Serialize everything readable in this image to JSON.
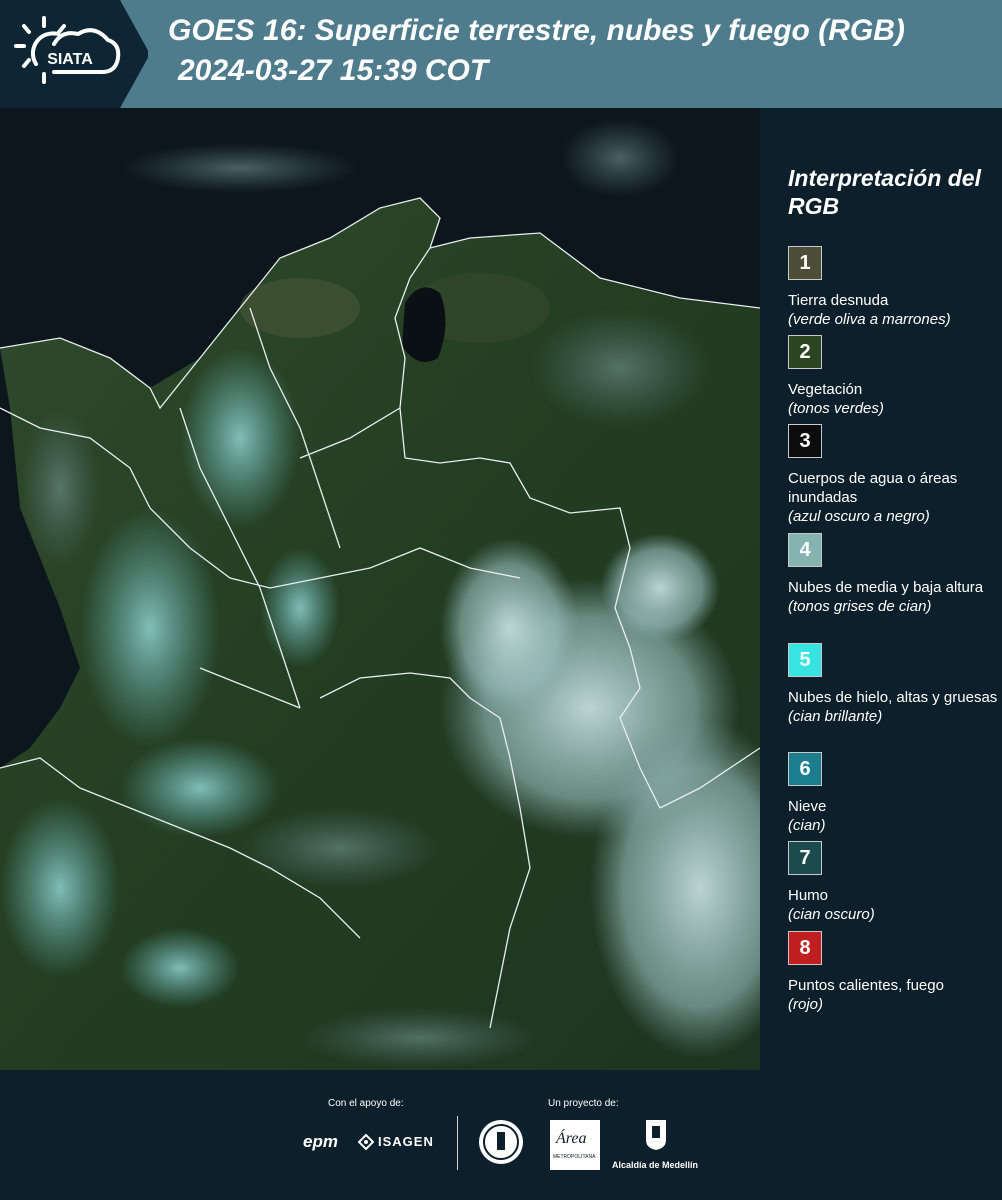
{
  "header": {
    "logo_text": "SIATA",
    "title_line1": "GOES 16: Superficie terrestre, nubes y fuego (RGB)",
    "title_line2": "2024-03-27 15:39 COT"
  },
  "legend": {
    "title": "Interpretación del RGB",
    "items": [
      {
        "num": "1",
        "label": "Tierra desnuda",
        "sub": "(verde oliva a marrones)",
        "color": "#4e4d38"
      },
      {
        "num": "2",
        "label": "Vegetación",
        "sub": "(tonos verdes)",
        "color": "#2b4520"
      },
      {
        "num": "3",
        "label": "Cuerpos de agua o áreas inundadas",
        "sub": "(azul oscuro a negro)",
        "color": "#0c0c0c"
      },
      {
        "num": "4",
        "label": "Nubes de media y baja altura",
        "sub": "(tonos grises de cian)",
        "color": "#86b3b1"
      },
      {
        "num": "5",
        "label": "Nubes de hielo, altas y gruesas",
        "sub": "(cian brillante)",
        "color": "#39e3e2"
      },
      {
        "num": "6",
        "label": "Nieve",
        "sub": "(cian)",
        "color": "#1c7d8f"
      },
      {
        "num": "7",
        "label": "Humo",
        "sub": "(cian oscuro)",
        "color": "#1c4b4d"
      },
      {
        "num": "8",
        "label": "Puntos calientes, fuego",
        "sub": "(rojo)",
        "color": "#c11f1f"
      }
    ]
  },
  "footer": {
    "support_label": "Con el apoyo de:",
    "project_label": "Un proyecto de:",
    "sponsor_epm": "epm",
    "sponsor_isagen": "ISAGEN",
    "sponsor_area": "Área",
    "sponsor_area_sub": "METROPOLITANA",
    "sponsor_alcaldia": "Alcaldía de Medellín"
  }
}
